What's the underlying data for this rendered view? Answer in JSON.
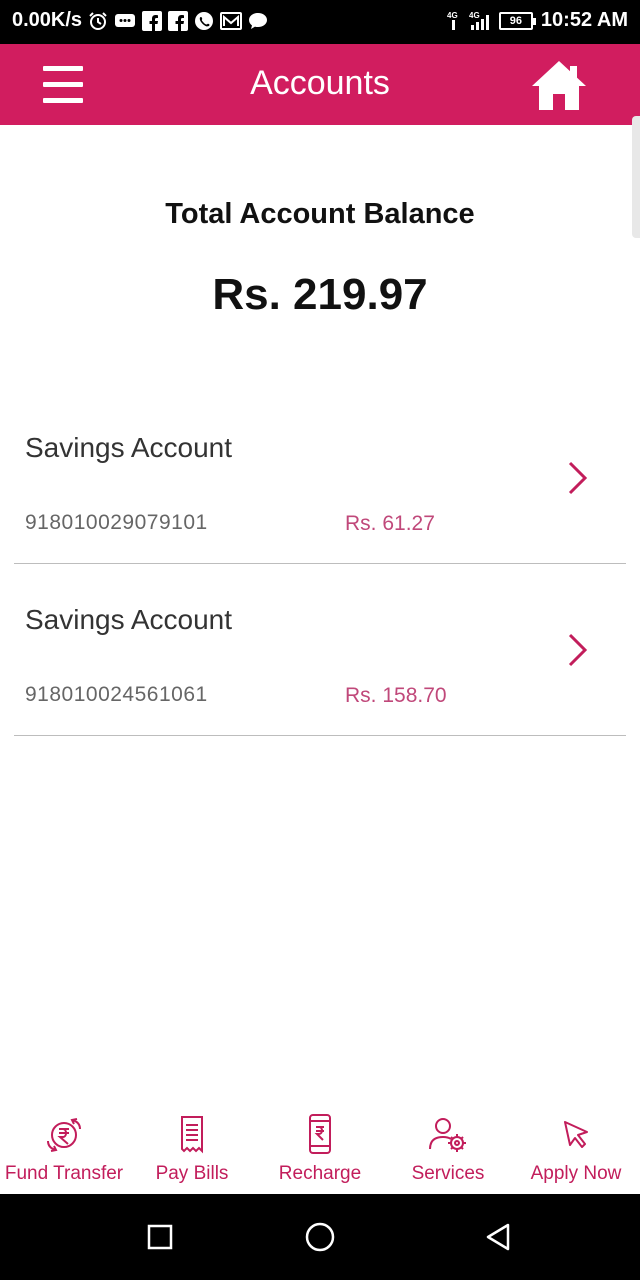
{
  "status_bar": {
    "net_speed": "0.00K/s",
    "battery": "96",
    "time": "10:52 AM",
    "icons": [
      "alarm-icon",
      "chat-bubble-icon",
      "facebook-icon",
      "facebook-icon",
      "whatsapp-icon",
      "mail-icon",
      "message-icon",
      "signal-4g-icon",
      "signal-4g-icon"
    ]
  },
  "header": {
    "title": "Accounts",
    "menu_icon": "hamburger-menu-icon",
    "home_icon": "home-icon",
    "color": "#d11d5f"
  },
  "summary": {
    "label": "Total Account Balance",
    "value": "Rs. 219.97"
  },
  "accounts": [
    {
      "name": "Savings Account",
      "number": "918010029079101",
      "balance": "Rs. 61.27"
    },
    {
      "name": "Savings Account",
      "number": "918010024561061",
      "balance": "Rs. 158.70"
    }
  ],
  "bottom_nav": [
    {
      "label": "Fund Transfer",
      "icon": "fund-transfer-icon"
    },
    {
      "label": "Pay Bills",
      "icon": "bill-receipt-icon"
    },
    {
      "label": "Recharge",
      "icon": "mobile-recharge-icon"
    },
    {
      "label": "Services",
      "icon": "services-gear-icon"
    },
    {
      "label": "Apply Now",
      "icon": "cursor-pointer-icon"
    }
  ],
  "colors": {
    "accent": "#d11d5f",
    "balance_text": "#c0487a",
    "nav_text": "#c21d5b"
  }
}
